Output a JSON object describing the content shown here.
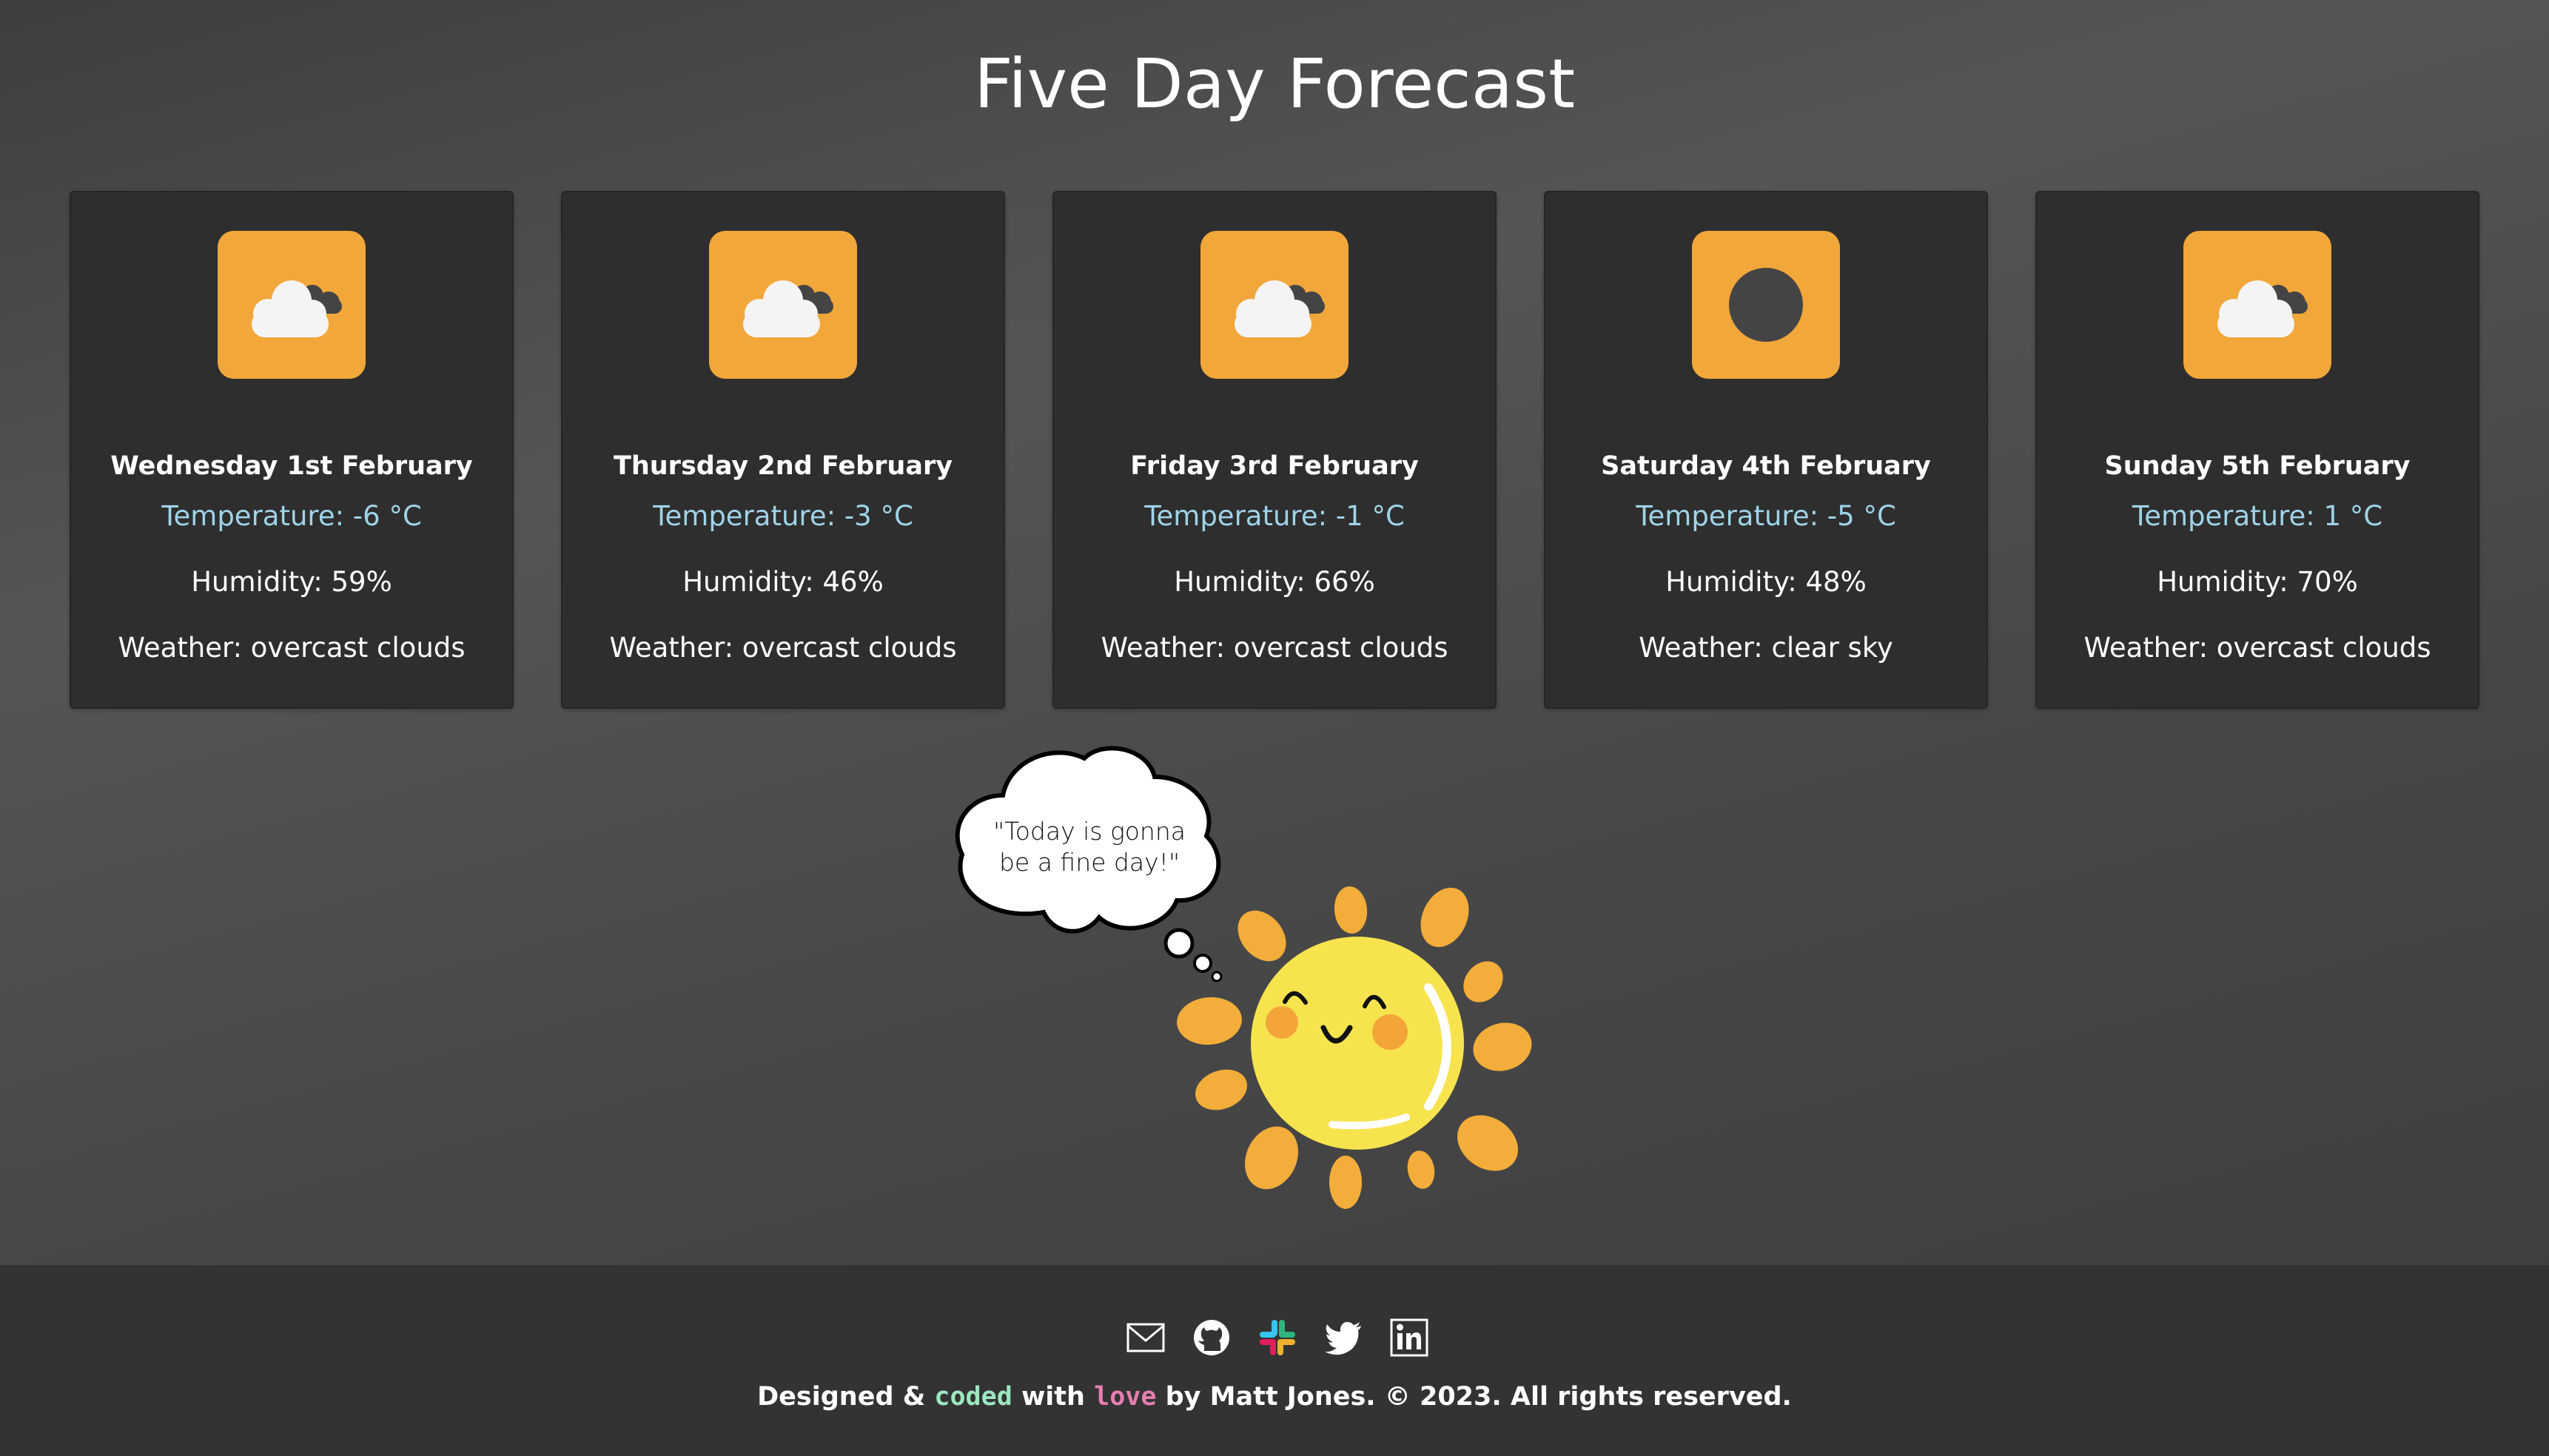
{
  "page": {
    "title": "Five Day Forecast"
  },
  "forecast": [
    {
      "date": "Wednesday 1st February",
      "temperature": "Temperature: -6 °C",
      "humidity": "Humidity: 59%",
      "weather": "Weather: overcast clouds",
      "icon": "overcast-clouds-icon"
    },
    {
      "date": "Thursday 2nd February",
      "temperature": "Temperature: -3 °C",
      "humidity": "Humidity: 46%",
      "weather": "Weather: overcast clouds",
      "icon": "overcast-clouds-icon"
    },
    {
      "date": "Friday 3rd February",
      "temperature": "Temperature: -1 °C",
      "humidity": "Humidity: 66%",
      "weather": "Weather: overcast clouds",
      "icon": "overcast-clouds-icon"
    },
    {
      "date": "Saturday 4th February",
      "temperature": "Temperature: -5 °C",
      "humidity": "Humidity: 48%",
      "weather": "Weather: clear sky",
      "icon": "clear-sky-icon"
    },
    {
      "date": "Sunday 5th February",
      "temperature": "Temperature: 1 °C",
      "humidity": "Humidity: 70%",
      "weather": "Weather: overcast clouds",
      "icon": "overcast-clouds-icon"
    }
  ],
  "mascot": {
    "thought_line1": "\"Today is gonna",
    "thought_line2": "be a fine day!\""
  },
  "footer": {
    "social_icons": [
      "email-icon",
      "github-icon",
      "slack-icon",
      "twitter-icon",
      "linkedin-icon"
    ],
    "credit_pre": "Designed & ",
    "credit_coded": "coded",
    "credit_with": " with ",
    "credit_love": "love",
    "credit_post": " by Matt Jones. © 2023. All rights reserved."
  },
  "colors": {
    "card_bg": "#2e2e2e",
    "icon_bg": "#f2a73b",
    "temperature_text": "#9fd3e8",
    "footer_bg": "#333333",
    "coded_text": "#9ee6c0",
    "love_text": "#e57fb1"
  }
}
